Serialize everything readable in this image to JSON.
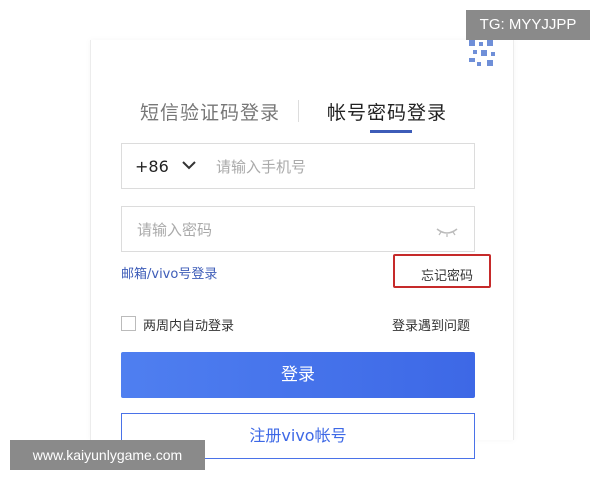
{
  "tabs": {
    "sms_label": "短信验证码登录",
    "password_label": "帐号密码登录"
  },
  "phone": {
    "country_code": "+86",
    "placeholder": "请输入手机号"
  },
  "password": {
    "placeholder": "请输入密码"
  },
  "links": {
    "email_login": "邮箱/vivo号登录",
    "forgot_password": "忘记密码",
    "remember_me": "两周内自动登录",
    "login_problem": "登录遇到问题"
  },
  "buttons": {
    "login": "登录",
    "register": "注册vivo帐号"
  },
  "watermarks": {
    "top": "TG: MYYJJPP",
    "bottom": "www.kaiyunlygame.com"
  },
  "colors": {
    "accent": "#3d68e6",
    "highlight_box": "#c62a2a"
  }
}
